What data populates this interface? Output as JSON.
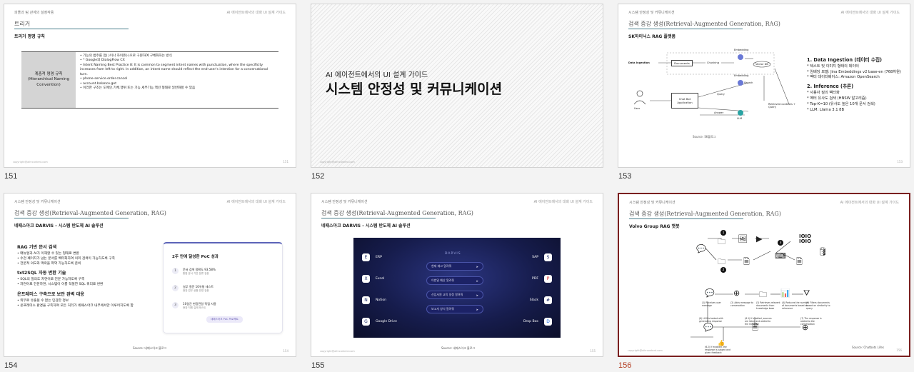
{
  "slides": [
    {
      "number": "151",
      "header_left": "피플과 팀 관계의 설정작용",
      "header_right": "AI 에이전트에서의 대화 UI 설계 가이드",
      "title": "트리거",
      "subtitle": "트리거 명명 규칙",
      "table": {
        "label": "계층적 명명 규칙\n(Hierarchical Naming Convention)",
        "bullets": [
          "기능의 범주를 점(.)이나 하이픈(-)으로 구분하여 구체화하는 방식",
          "* Google의 DialogFlow CX",
          "Intent Naming Best Practice 8: It is common to segment intent names with punctuation, where the specificity increases from left to right. In addition, an intent name should reflect the end-user's intention for a conversational turn.",
          "phone-service.order.cancel",
          "account.balance.get",
          "이러한 구조는 도메인.기체.행위 또는 기능.세부기능.액션 형태로 일반화할 수 있음"
        ]
      },
      "footer_left": "copyright@aihrcontent.com",
      "footer_right": "151"
    },
    {
      "number": "152",
      "subtitle": "AI 에이전트에서의 UI 설계 가이드",
      "main_title": "시스템 안정성 및 커뮤니케이션",
      "footer_left": "copyright@aihrcontent.com"
    },
    {
      "number": "153",
      "header_left": "시스템 안정성 및 커뮤니케이션",
      "header_right": "AI 에이전트에서의 대화 UI 설계 가이드",
      "title": "검색 증강 생성(Retrieval-Augmented Generation, RAG)",
      "subtitle": "SK하이닉스 RAG 플랫폼",
      "diagram": {
        "data_ingestion": "Data Ingestion",
        "documents": "Documents",
        "chunking": "Chunking",
        "embedding_top": "Embedding",
        "vector_db": "Vector DB",
        "embedding_mid": "Embedding",
        "search": "Search",
        "query": "Query",
        "chat_bot": "Chat Bot Application",
        "user": "User",
        "answer": "Answer",
        "llm": "LLM",
        "retrieved": "Retrieved contexts + Query"
      },
      "right_panel": {
        "h1": "1. Data Ingestion (데이터 수집)",
        "i1": [
          "* 텍스트 및 이미지 형태의 데이터",
          "* 임베딩 모델: Jina Embeddings v2 base-en (768차원)",
          "* 벡터 데이터베이스: Amazon OpenSearch"
        ],
        "h2": "2. Inference (추론)",
        "i2": [
          "* 사용자 질의 벡터화",
          "* 벡터 유사도 검색 (HNSW 알고리즘)",
          "* Top-K=10 (유사도 높은 10개 문서 검색)",
          "* LLM: Llama 3.1 8B"
        ]
      },
      "source": "Source: SK블로그",
      "footer_right": "153"
    },
    {
      "number": "154",
      "header_left": "시스템 안정성 및 커뮤니케이션",
      "header_right": "AI 에이전트에서의 대화 UI 설계 가이드",
      "title": "검색 증강 생성(Retrieval-Augmented Generation, RAG)",
      "subtitle": "네패스아크 DARVIS - 시스템 반도체 AI 솔루션",
      "sections": [
        {
          "heading": "RAG 기반 문서 검색",
          "bullets": [
            "매뉴얼과 AI가 이해할 수 있는 형태로 변환",
            "수천 페이지가 넘는 문서를 벡터화하여 의미 검색이 가능하도록 구축",
            "전문적 의도와 맥락을 파악 가능하도록 준비"
          ]
        },
        {
          "heading": "txt2SQL 자동 변환 기술",
          "bullets": [
            "SQL의 질의도 자연어로 전문 가능하도록 구축",
            "자연어로 전문하면, 시스템이 이를 적절한 SQL 쿼리로 변환"
          ]
        },
        {
          "heading": "온프레미스 구축으로 보안 완벽 대응",
          "bullets": [
            "외부로 유출될 수 없는 민감한 정보",
            "온프레미스 환경을 구축하여 모든 처리가 네패스아크 내부에서만 이루어지도록 함"
          ]
        }
      ],
      "card": {
        "title": "2주 만에 달성한 PoC 성과",
        "items": [
          {
            "n": "1",
            "text": "문서 검색 정확도 93.58%",
            "sub": "통합 문서 기반 분류 검증"
          },
          {
            "n": "2",
            "text": "실무 질문 10유형 테스트",
            "sub": "현장 업무 상황 반영 검증"
          },
          {
            "n": "3",
            "text": "10일간 현장전달 직접 사용",
            "sub": "현장 직원 실제 테스트"
          }
        ],
        "pill": "네패스아크 PoC 프로젝트"
      },
      "source": "Source: 네패스아크 블로그",
      "footer_right": "154"
    },
    {
      "number": "155",
      "header_left": "시스템 안정성 및 커뮤니케이션",
      "header_right": "AI 에이전트에서의 대화 UI 설계 가이드",
      "title": "검색 증강 생성(Retrieval-Augmented Generation, RAG)",
      "subtitle": "네패스아크 DARVIS - 시스템 반도체 AI 솔루션",
      "darvis": {
        "brand": "DARVIS",
        "left": [
          {
            "icon": "E",
            "label": "ERP"
          },
          {
            "icon": "X",
            "label": "Excel"
          },
          {
            "icon": "N",
            "label": "Notion"
          },
          {
            "icon": "G",
            "label": "Google Drive"
          }
        ],
        "mid": [
          "현재 재고 알려줘",
          "이번달 예산 알려줘",
          "신입사원 교육 일정 알려줘",
          "보고서 양식 알려줘"
        ],
        "right": [
          {
            "icon": "S",
            "label": "SAP"
          },
          {
            "icon": "P",
            "label": "PDF"
          },
          {
            "icon": "#",
            "label": "Slack"
          },
          {
            "icon": "D",
            "label": "Drop Box"
          }
        ]
      },
      "source": "Source: 네패스아크 블로그",
      "footer_left": "copyright@aihrcontent.com",
      "footer_right": "155"
    },
    {
      "number": "156",
      "header_left": "시스템 안정성 및 커뮤니케이션",
      "header_right": "AI 에이전트에서의 대화 UI 설계 가이드",
      "title": "검색 증강 생성(Retrieval-Augmented Generation, RAG)",
      "subtitle": "Volvo Group RAG 챗봇",
      "steps_row2": [
        "(1) Receives user message",
        "(2) Adds message to conversation",
        "(3) Retrieves relevant documents from knowledge base",
        "(4) Reduces the number of documents based on relevance",
        "(5) Filters documents based on similarity to query"
      ],
      "steps_row3": [
        "(6) LLM is tasked with generating response",
        "(6.1) If enabled, sources are listed and added to the message",
        "(7) The response is added to the conversation"
      ],
      "step_bottom": "(6.2) If enabled, the response is judged and given feedback",
      "source": "Source: Chatbots Lifes",
      "footer_left": "copyright@aihrcontent.com",
      "footer_right": "156"
    }
  ]
}
